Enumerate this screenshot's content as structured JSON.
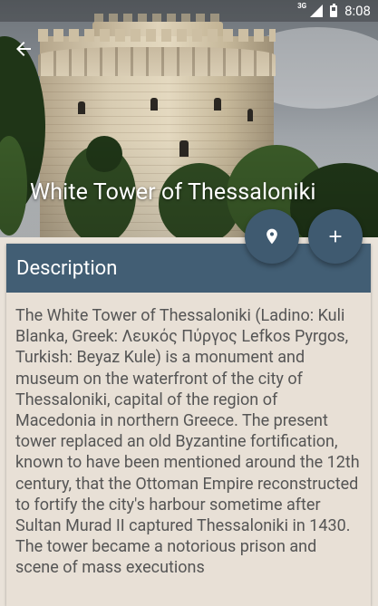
{
  "status_bar": {
    "network": "3G",
    "time": "8:08"
  },
  "header": {
    "title": "White Tower of Thessaloniki",
    "back_icon": "arrow-back-icon"
  },
  "fabs": {
    "map_icon": "map-marker-icon",
    "add_icon": "plus-icon"
  },
  "description": {
    "heading": "Description",
    "text": "The White Tower of Thessaloniki (Ladino: Kuli Blanka, Greek: Λευκός Πύργος Lefkos Pyrgos, Turkish: Beyaz Kule) is a monument and museum on the waterfront of the city of Thessaloniki, capital of the region of Macedonia in northern Greece. The present tower replaced an old Byzantine fortification, known to have been mentioned around the 12th century, that the Ottoman Empire reconstructed to fortify the city's harbour sometime after Sultan Murad II captured Thessaloniki in 1430. The tower became a notorious prison and scene of mass executions"
  },
  "colors": {
    "primary": "#425e74",
    "fab": "#3f5a70",
    "card_background": "#e8e0d6"
  }
}
